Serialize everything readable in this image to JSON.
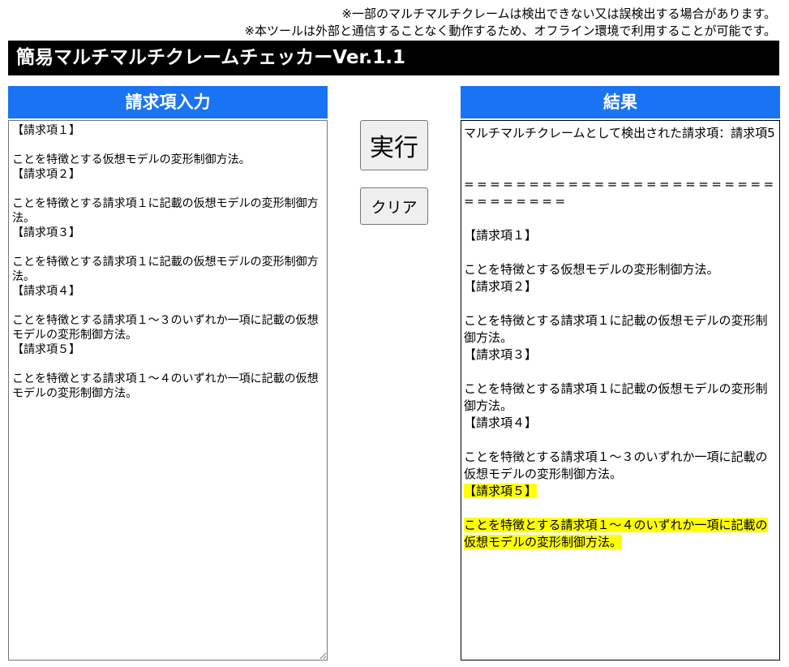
{
  "notes": {
    "line1": "※一部のマルチマルチクレームは検出できない又は誤検出する場合があります。",
    "line2": "※本ツールは外部と通信することなく動作するため、オフライン環境で利用することが可能です。"
  },
  "title": "簡易マルチマルチクレームチェッカーVer.1.1",
  "input_panel": {
    "heading": "請求項入力",
    "value": "【請求項１】\n\nことを特徴とする仮想モデルの変形制御方法。\n【請求項２】\n\nことを特徴とする請求項１に記載の仮想モデルの変形制御方法。\n【請求項３】\n\nことを特徴とする請求項１に記載の仮想モデルの変形制御方法。\n【請求項４】\n\nことを特徴とする請求項１～３のいずれか一項に記載の仮想モデルの変形制御方法。\n【請求項５】\n\nことを特徴とする請求項１～４のいずれか一項に記載の仮想モデルの変形制御方法。"
  },
  "buttons": {
    "run": "実行",
    "clear": "クリア"
  },
  "result_panel": {
    "heading": "結果",
    "summary": "マルチマルチクレームとして検出された請求項：請求項5",
    "separator": "================================",
    "lines": [
      {
        "text": "【請求項１】",
        "highlight": false
      },
      {
        "text": "",
        "highlight": false
      },
      {
        "text": "ことを特徴とする仮想モデルの変形制御方法。",
        "highlight": false
      },
      {
        "text": "【請求項２】",
        "highlight": false
      },
      {
        "text": "",
        "highlight": false
      },
      {
        "text": "ことを特徴とする請求項１に記載の仮想モデルの変形制御方法。",
        "highlight": false
      },
      {
        "text": "【請求項３】",
        "highlight": false
      },
      {
        "text": "",
        "highlight": false
      },
      {
        "text": "ことを特徴とする請求項１に記載の仮想モデルの変形制御方法。",
        "highlight": false
      },
      {
        "text": "【請求項４】",
        "highlight": false
      },
      {
        "text": "",
        "highlight": false
      },
      {
        "text": "ことを特徴とする請求項１～３のいずれか一項に記載の仮想モデルの変形制御方法。",
        "highlight": false
      },
      {
        "text": "【請求項５】",
        "highlight": true
      },
      {
        "text": "",
        "highlight": false
      },
      {
        "text": "ことを特徴とする請求項１～４のいずれか一項に記載の仮想モデルの変形制御方法。",
        "highlight": true
      }
    ],
    "highlight_color": "#ffff00"
  },
  "colors": {
    "title_bg": "#000000",
    "panel_head_bg": "#1a73f2"
  }
}
